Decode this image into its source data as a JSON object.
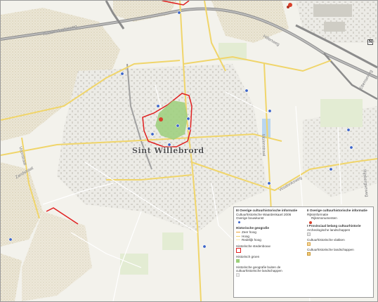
{
  "map": {
    "town_label": "Sint Willebrord",
    "streets": {
      "roosendaalseweg": "Roosendaalseweg",
      "hillenweg": "Hillenweg",
      "voorstraat": "Voorstraat",
      "zandstraat": "Zandstraat",
      "vosdonksweg": "Vosdonksweg",
      "molenstraat": "Molenstraat",
      "rijsbergseweg": "Rijsbergseweg",
      "ettenseweg": "Ettenseweg",
      "hoeveelseweg": "Hoeveelseweg"
    },
    "road_badge": "N"
  },
  "legend": {
    "left": {
      "section1_title": "III Overige cultuurhistorische informatie",
      "section1_sub": "Cultuurhistorische Waardenkaart 2006",
      "item_bouwkunst": "Overige bouwkunst",
      "section2_title": "Historische geografie",
      "item_zeer_hoog": "Zeer hoog",
      "item_hoog": "Hoog",
      "item_redelijk_hoog": "Redelijk hoog",
      "item_stedenbouw": "Historische stedenbouw",
      "item_groen": "Historisch groen",
      "item_buiten": "Historische geografie buiten de cultuurhistorische landschappen"
    },
    "right": {
      "section1_title": "II Overige cultuurhistorische informatie",
      "section1_sub": "Rijksinformatie",
      "item_rijksmonumenten": "Rijksmonumenten",
      "section2_title": "I Provinciaal belang cultuurhistorie",
      "item_arch": "Archeologische landschappen",
      "item_vlakken": "Cultuurhistorische vlakken",
      "item_landschappen": "Cultuurhistorische landschappen"
    },
    "colors": {
      "zeer_hoog": "#e8a030",
      "hoog": "#f2d26a",
      "redelijk_hoog": "#f7e7a8",
      "stedenbouw": "#e02020",
      "groen": "#9ccf7a",
      "rijksmonument": "#d9402a",
      "bouwkunst": "#3a63c8",
      "arch": "#e6e6e6",
      "vlakken": "#f5d59b",
      "landschappen": "#f2c979"
    }
  }
}
